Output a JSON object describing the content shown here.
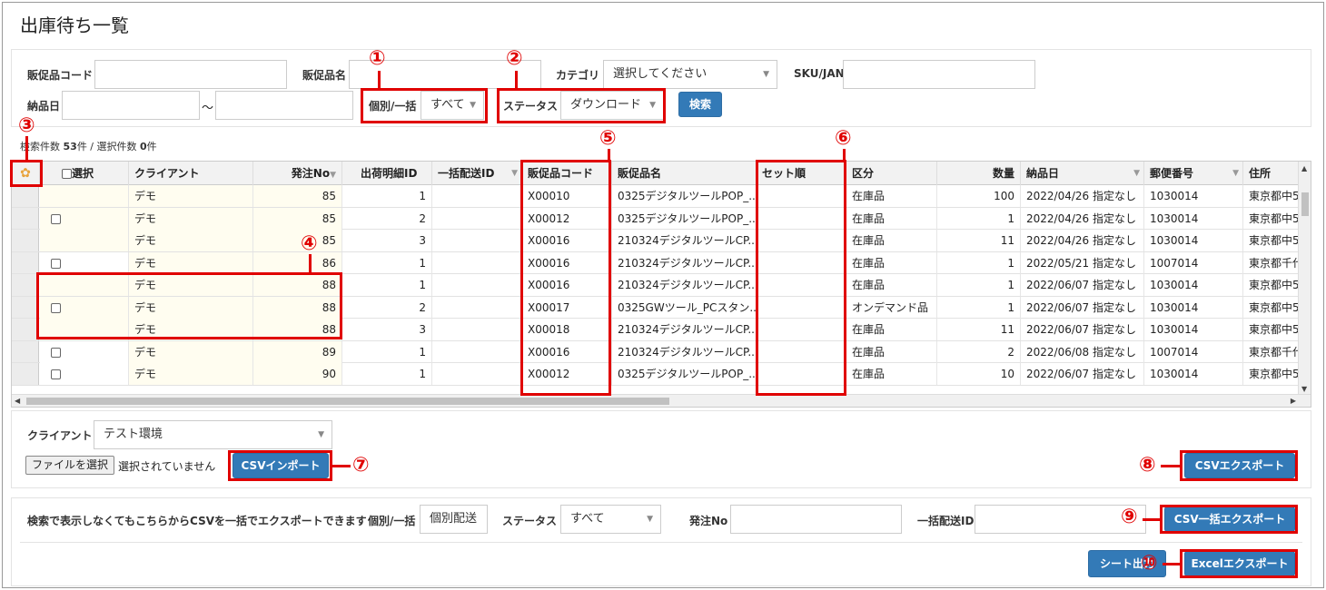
{
  "title": "出庫待ち一覧",
  "search": {
    "product_code_label": "販促品コード",
    "product_name_label": "販促品名",
    "category_label": "カテゴリ",
    "category_value": "選択してください",
    "sku_label": "SKU/JAN",
    "delivery_date_label": "納品日",
    "date_sep": "〜",
    "individual_label": "個別/一括",
    "individual_value": "すべて",
    "status_label": "ステータス",
    "status_value": "ダウンロード",
    "search_button": "検索"
  },
  "result_count": {
    "prefix": "検索件数 ",
    "hits": "53",
    "mid": "件 / 選択件数 ",
    "selected": "0",
    "suffix": "件"
  },
  "grid": {
    "headers": {
      "select": "選択",
      "client": "クライアント",
      "order_no": "発注No",
      "ship_detail_id": "出荷明細ID",
      "batch_id": "一括配送ID",
      "product_code": "販促品コード",
      "product_name": "販促品名",
      "set_order": "セット順",
      "kubun": "区分",
      "qty": "数量",
      "delivery_date": "納品日",
      "postal": "郵便番号",
      "address": "住所"
    },
    "rows": [
      {
        "client": "デモ",
        "order_no": "85",
        "detail": "1",
        "code": "X00010",
        "name": "0325デジタルツールPOP_...",
        "kubun": "在庫品",
        "qty": "100",
        "date": "2022/04/26 指定なし",
        "postal": "1030014",
        "addr": "東京都中5"
      },
      {
        "client": "デモ",
        "order_no": "85",
        "detail": "2",
        "code": "X00012",
        "name": "0325デジタルツールPOP_...",
        "kubun": "在庫品",
        "qty": "1",
        "date": "2022/04/26 指定なし",
        "postal": "1030014",
        "addr": "東京都中5"
      },
      {
        "client": "デモ",
        "order_no": "85",
        "detail": "3",
        "code": "X00016",
        "name": "210324デジタルツールCP...",
        "kubun": "在庫品",
        "qty": "11",
        "date": "2022/04/26 指定なし",
        "postal": "1030014",
        "addr": "東京都中5"
      },
      {
        "client": "デモ",
        "order_no": "86",
        "detail": "1",
        "code": "X00016",
        "name": "210324デジタルツールCP...",
        "kubun": "在庫品",
        "qty": "1",
        "date": "2022/05/21 指定なし",
        "postal": "1007014",
        "addr": "東京都千代"
      },
      {
        "client": "デモ",
        "order_no": "88",
        "detail": "1",
        "code": "X00016",
        "name": "210324デジタルツールCP...",
        "kubun": "在庫品",
        "qty": "1",
        "date": "2022/06/07 指定なし",
        "postal": "1030014",
        "addr": "東京都中5"
      },
      {
        "client": "デモ",
        "order_no": "88",
        "detail": "2",
        "code": "X00017",
        "name": "0325GWツール_PCスタン...",
        "kubun": "オンデマンド品",
        "qty": "1",
        "date": "2022/06/07 指定なし",
        "postal": "1030014",
        "addr": "東京都中5"
      },
      {
        "client": "デモ",
        "order_no": "88",
        "detail": "3",
        "code": "X00018",
        "name": "210324デジタルツールCP...",
        "kubun": "在庫品",
        "qty": "11",
        "date": "2022/06/07 指定なし",
        "postal": "1030014",
        "addr": "東京都中5"
      },
      {
        "client": "デモ",
        "order_no": "89",
        "detail": "1",
        "code": "X00016",
        "name": "210324デジタルツールCP...",
        "kubun": "在庫品",
        "qty": "2",
        "date": "2022/06/08 指定なし",
        "postal": "1007014",
        "addr": "東京都千代"
      },
      {
        "client": "デモ",
        "order_no": "90",
        "detail": "1",
        "code": "X00012",
        "name": "0325デジタルツールPOP_...",
        "kubun": "在庫品",
        "qty": "10",
        "date": "2022/06/07 指定なし",
        "postal": "1030014",
        "addr": "東京都中5"
      }
    ]
  },
  "import_panel": {
    "client_label": "クライアント",
    "client_value": "テスト環境",
    "file_button": "ファイルを選択",
    "file_status": "選択されていません",
    "csv_import": "CSVインポート",
    "csv_export": "CSVエクスポート"
  },
  "bulk_panel": {
    "note": "検索で表示しなくてもこちらからCSVを一括でエクスポートできます",
    "individual_label": "個別/一括",
    "individual_value": "個別配送",
    "status_label": "ステータス",
    "status_value": "すべて",
    "order_no_label": "発注No",
    "batch_id_label": "一括配送ID",
    "csv_bulk_export": "CSV一括エクスポート",
    "sheet_button": "シート出力",
    "excel_export": "Excelエクスポート"
  },
  "annotations": [
    "①",
    "②",
    "③",
    "④",
    "⑤",
    "⑥",
    "⑦",
    "⑧",
    "⑨",
    "⑩"
  ],
  "colors": {
    "accent": "#337ab7",
    "annotation": "#e00000",
    "gear": "#e8a33c"
  }
}
